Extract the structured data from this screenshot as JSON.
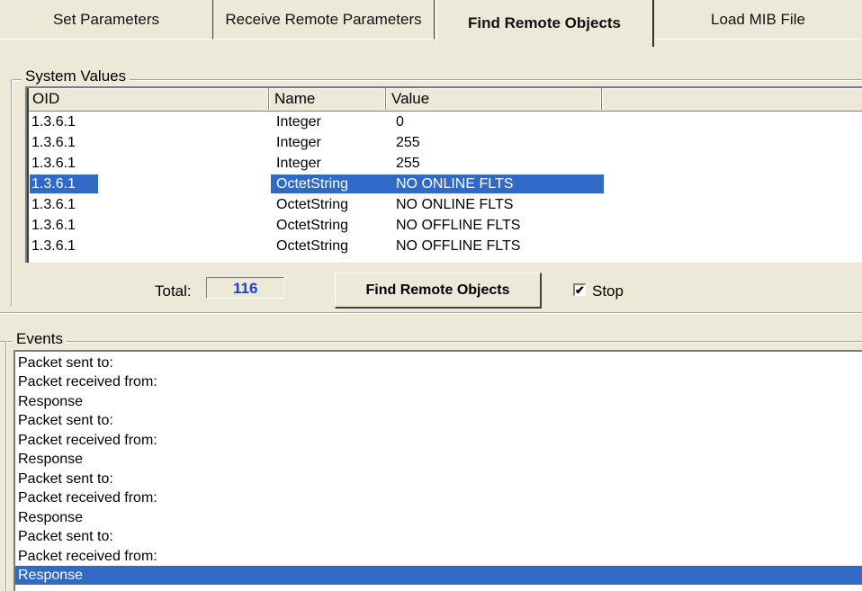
{
  "tabs": [
    {
      "label": "Set Parameters",
      "active": false
    },
    {
      "label": "Receive Remote Parameters",
      "active": false
    },
    {
      "label": "Find Remote Objects",
      "active": true
    },
    {
      "label": "Load MIB File",
      "active": false
    }
  ],
  "system_values": {
    "title": "System Values",
    "columns": [
      "OID",
      "Name",
      "Value"
    ],
    "rows": [
      {
        "oid": "1.3.6.1",
        "name": "Integer",
        "value": "0"
      },
      {
        "oid": "1.3.6.1",
        "name": "Integer",
        "value": "255"
      },
      {
        "oid": "1.3.6.1",
        "name": "Integer",
        "value": "255"
      },
      {
        "oid": "1.3.6.1",
        "name": "OctetString",
        "value": "NO ONLINE FLTS"
      },
      {
        "oid": "1.3.6.1",
        "name": "OctetString",
        "value": "NO ONLINE FLTS"
      },
      {
        "oid": "1.3.6.1",
        "name": "OctetString",
        "value": "NO OFFLINE FLTS"
      },
      {
        "oid": "1.3.6.1",
        "name": "OctetString",
        "value": "NO OFFLINE FLTS"
      }
    ],
    "selected_row": 3
  },
  "controls": {
    "total_label": "Total:",
    "total_value": "116",
    "find_button": "Find Remote Objects",
    "stop_label": "Stop",
    "stop_checked": true,
    "check_mark": "✔"
  },
  "events": {
    "title": "Events",
    "lines": [
      "Packet sent to:",
      "Packet received from:",
      "Response",
      "Packet sent to:",
      "Packet received from:",
      "Response",
      "Packet sent to:",
      "Packet received from:",
      "Response",
      "Packet sent to:",
      "Packet received from:",
      "Response"
    ],
    "selected_line": 11
  },
  "colors": {
    "window_bg": "#ece9d8",
    "selection": "#316ac5",
    "total_value": "#1f3fd6"
  }
}
